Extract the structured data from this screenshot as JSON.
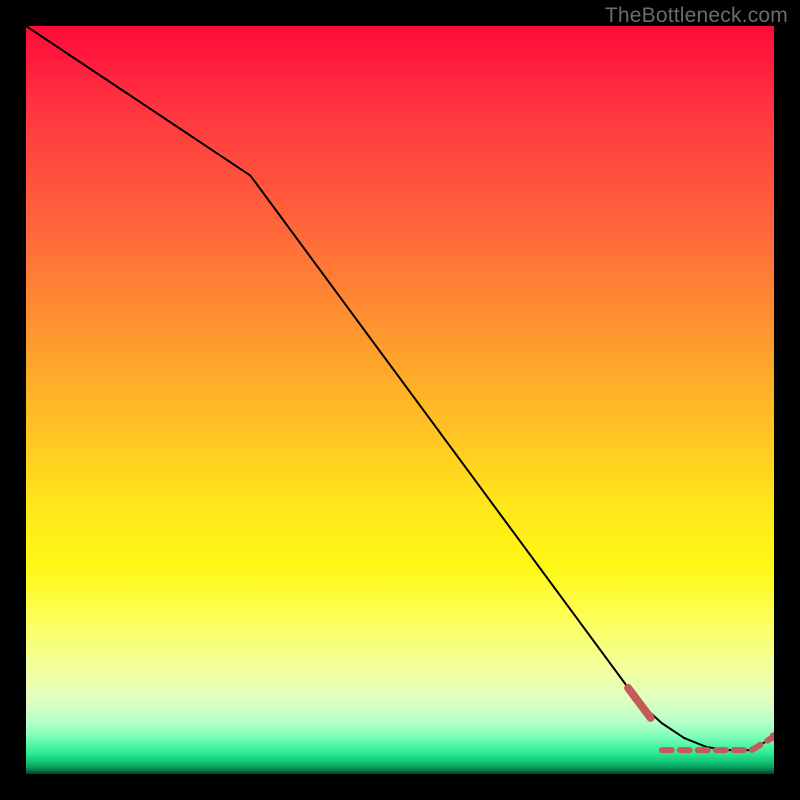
{
  "attribution": "TheBottleneck.com",
  "chart_data": {
    "type": "line",
    "title": "",
    "xlabel": "",
    "ylabel": "",
    "xlim": [
      0,
      100
    ],
    "ylim": [
      0,
      100
    ],
    "grid": false,
    "series": [
      {
        "name": "curve",
        "color": "#000000",
        "style": "solid",
        "x": [
          0,
          30,
          82,
          85,
          88,
          91,
          94,
          97,
          100
        ],
        "y": [
          100,
          80,
          9.5,
          6.8,
          4.8,
          3.6,
          3.2,
          3.2,
          5.0
        ]
      },
      {
        "name": "highlight-segment",
        "color": "#c65a5a",
        "style": "thick-solid",
        "x": [
          80.5,
          83.5
        ],
        "y": [
          11.5,
          7.5
        ]
      },
      {
        "name": "bottom-dots",
        "color": "#c65a5a",
        "style": "dashed-markers",
        "x": [
          85,
          87,
          89,
          91,
          93,
          95,
          97,
          100
        ],
        "y": [
          3.2,
          3.2,
          3.2,
          3.2,
          3.2,
          3.2,
          3.2,
          5.0
        ]
      }
    ]
  }
}
